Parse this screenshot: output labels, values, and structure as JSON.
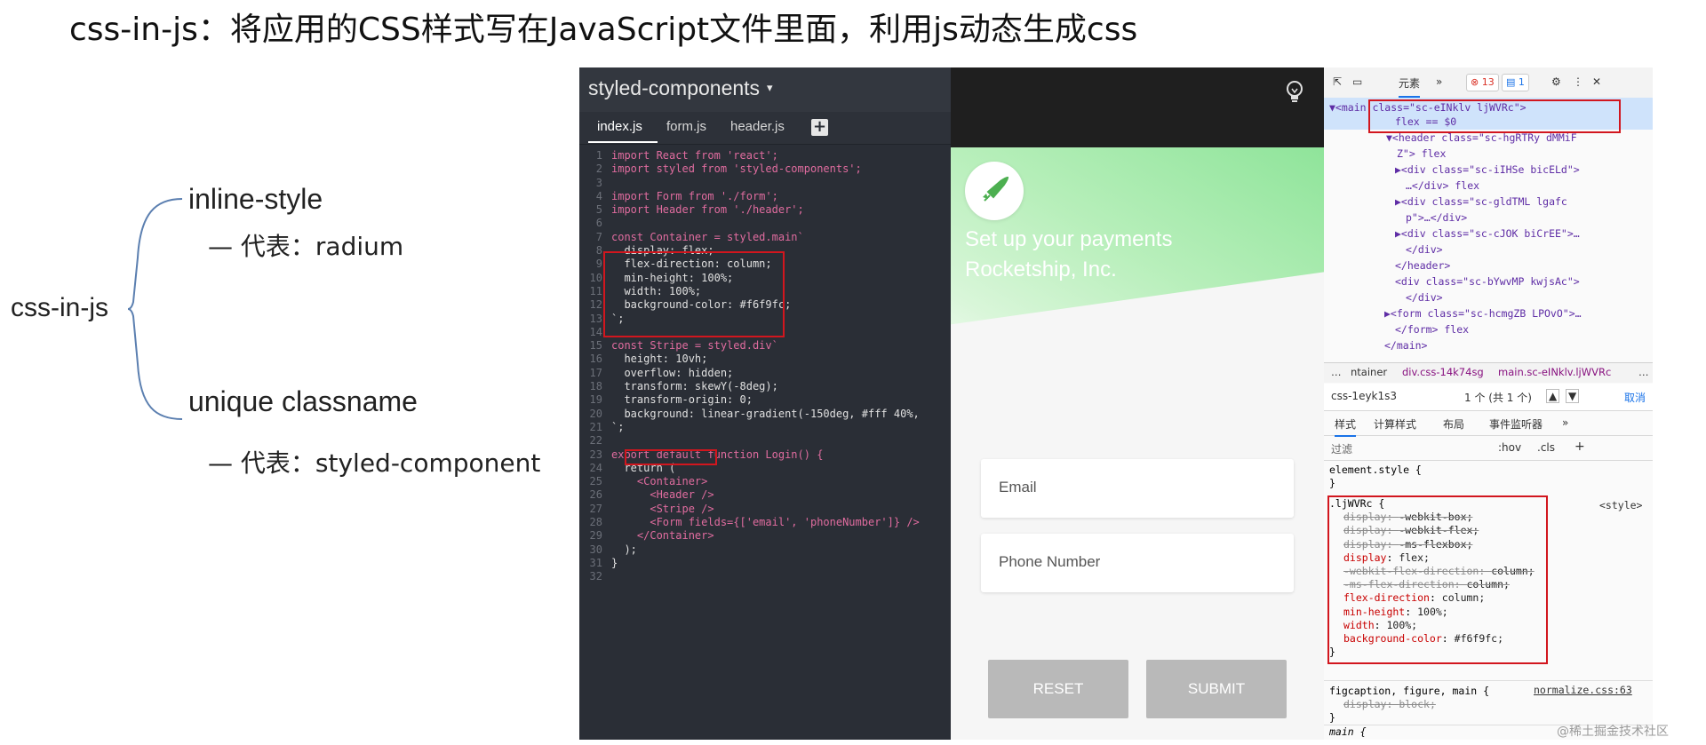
{
  "heading": "css-in-js：将应用的CSS样式写在JavaScript文件里面，利用js动态生成css",
  "mindmap": {
    "root": "css-in-js",
    "branches": [
      {
        "label": "inline-style",
        "note": "— 代表：radium"
      },
      {
        "label": "unique classname",
        "note": "— 代表：styled-component"
      }
    ]
  },
  "editor": {
    "title": "styled-components",
    "caret": "▾",
    "tabs": [
      "index.js",
      "form.js",
      "header.js"
    ],
    "add_tab": "+",
    "lines": [
      {
        "n": "1",
        "t": "import React from 'react';"
      },
      {
        "n": "2",
        "t": "import styled from 'styled-components';"
      },
      {
        "n": "3",
        "t": ""
      },
      {
        "n": "4",
        "t": "import Form from './form';"
      },
      {
        "n": "5",
        "t": "import Header from './header';"
      },
      {
        "n": "6",
        "t": ""
      },
      {
        "n": "7",
        "t": "const Container = styled.main`"
      },
      {
        "n": "8",
        "t": "  display: flex;"
      },
      {
        "n": "9",
        "t": "  flex-direction: column;"
      },
      {
        "n": "10",
        "t": "  min-height: 100%;"
      },
      {
        "n": "11",
        "t": "  width: 100%;"
      },
      {
        "n": "12",
        "t": "  background-color: #f6f9fc;"
      },
      {
        "n": "13",
        "t": "`;"
      },
      {
        "n": "14",
        "t": ""
      },
      {
        "n": "15",
        "t": "const Stripe = styled.div`"
      },
      {
        "n": "16",
        "t": "  height: 10vh;"
      },
      {
        "n": "17",
        "t": "  overflow: hidden;"
      },
      {
        "n": "18",
        "t": "  transform: skewY(-8deg);"
      },
      {
        "n": "19",
        "t": "  transform-origin: 0;"
      },
      {
        "n": "20",
        "t": "  background: linear-gradient(-150deg, #fff 40%,"
      },
      {
        "n": "21",
        "t": "`;"
      },
      {
        "n": "22",
        "t": ""
      },
      {
        "n": "23",
        "t": "export default function Login() {"
      },
      {
        "n": "24",
        "t": "  return ("
      },
      {
        "n": "25",
        "t": "    <Container>"
      },
      {
        "n": "26",
        "t": "      <Header />"
      },
      {
        "n": "27",
        "t": "      <Stripe />"
      },
      {
        "n": "28",
        "t": "      <Form fields={['email', 'phoneNumber']} />"
      },
      {
        "n": "29",
        "t": "    </Container>"
      },
      {
        "n": "30",
        "t": "  );"
      },
      {
        "n": "31",
        "t": "}"
      },
      {
        "n": "32",
        "t": ""
      }
    ]
  },
  "preview": {
    "line1": "Set up your payments",
    "line2": "Rocketship, Inc.",
    "email_placeholder": "Email",
    "phone_placeholder": "Phone Number",
    "reset": "RESET",
    "submit": "SUBMIT"
  },
  "devtools": {
    "tab_elements": "元素",
    "more": "»",
    "errors": "13",
    "messages": "1",
    "dom": [
      "▼<main class=\"sc-eINklv ljWVRc\">",
      "flex == $0",
      "▼<header class=\"sc-hgRTRy dMMiF",
      "Z\"> flex",
      "▶<div class=\"sc-iIHSe bicELd\">",
      "…</div> flex",
      "▶<div class=\"sc-gldTML lgafc",
      "p\">…</div>",
      "▶<div class=\"sc-cJOK biCrEE\">…",
      "</div>",
      "</header>",
      "<div class=\"sc-bYwvMP kwjsAc\">",
      "</div>",
      "▶<form class=\"sc-hcmgZB LPOvO\">…",
      "</form> flex",
      "</main>"
    ],
    "breadcrumbs": [
      "…",
      "ntainer",
      "div.css-14k74sg",
      "main.sc-eINklv.ljWVRc",
      "…"
    ],
    "search_value": "css-1eyk1s3",
    "search_count": "1 个 (共 1 个)",
    "cancel": "取消",
    "panel_tabs": [
      "样式",
      "计算样式",
      "布局",
      "事件监听器",
      "»"
    ],
    "filter_placeholder": "过滤",
    "filter_tools": [
      ":hov",
      ".cls",
      "+"
    ],
    "element_style": "element.style {",
    "rule_selector": ".ljWVRc {",
    "rule_source": "<style>",
    "rule_lines": [
      {
        "p": "display",
        "v": "-webkit-box;",
        "s": true
      },
      {
        "p": "display",
        "v": "-webkit-flex;",
        "s": true
      },
      {
        "p": "display",
        "v": "-ms-flexbox;",
        "s": true
      },
      {
        "p": "display",
        "v": "flex;",
        "s": false
      },
      {
        "p": "-webkit-flex-direction",
        "v": "column;",
        "s": true
      },
      {
        "p": "-ms-flex-direction",
        "v": "column;",
        "s": true
      },
      {
        "p": "flex-direction",
        "v": "column;",
        "s": false
      },
      {
        "p": "min-height",
        "v": "100%;",
        "s": false
      },
      {
        "p": "width",
        "v": "100%;",
        "s": false
      },
      {
        "p": "background-color",
        "v": "#f6f9fc;",
        "s": false
      }
    ],
    "rule2_selector": "figcaption, figure, main {",
    "rule2_source": "normalize.css:63",
    "rule2_line": {
      "p": "display",
      "v": "block;"
    },
    "rule3_selector": "main {"
  },
  "watermark": "@稀土掘金技术社区",
  "colors": {
    "highlight": "#d2161e",
    "preview_green": "#8fe49a",
    "button_gray": "#b9b9b9"
  }
}
